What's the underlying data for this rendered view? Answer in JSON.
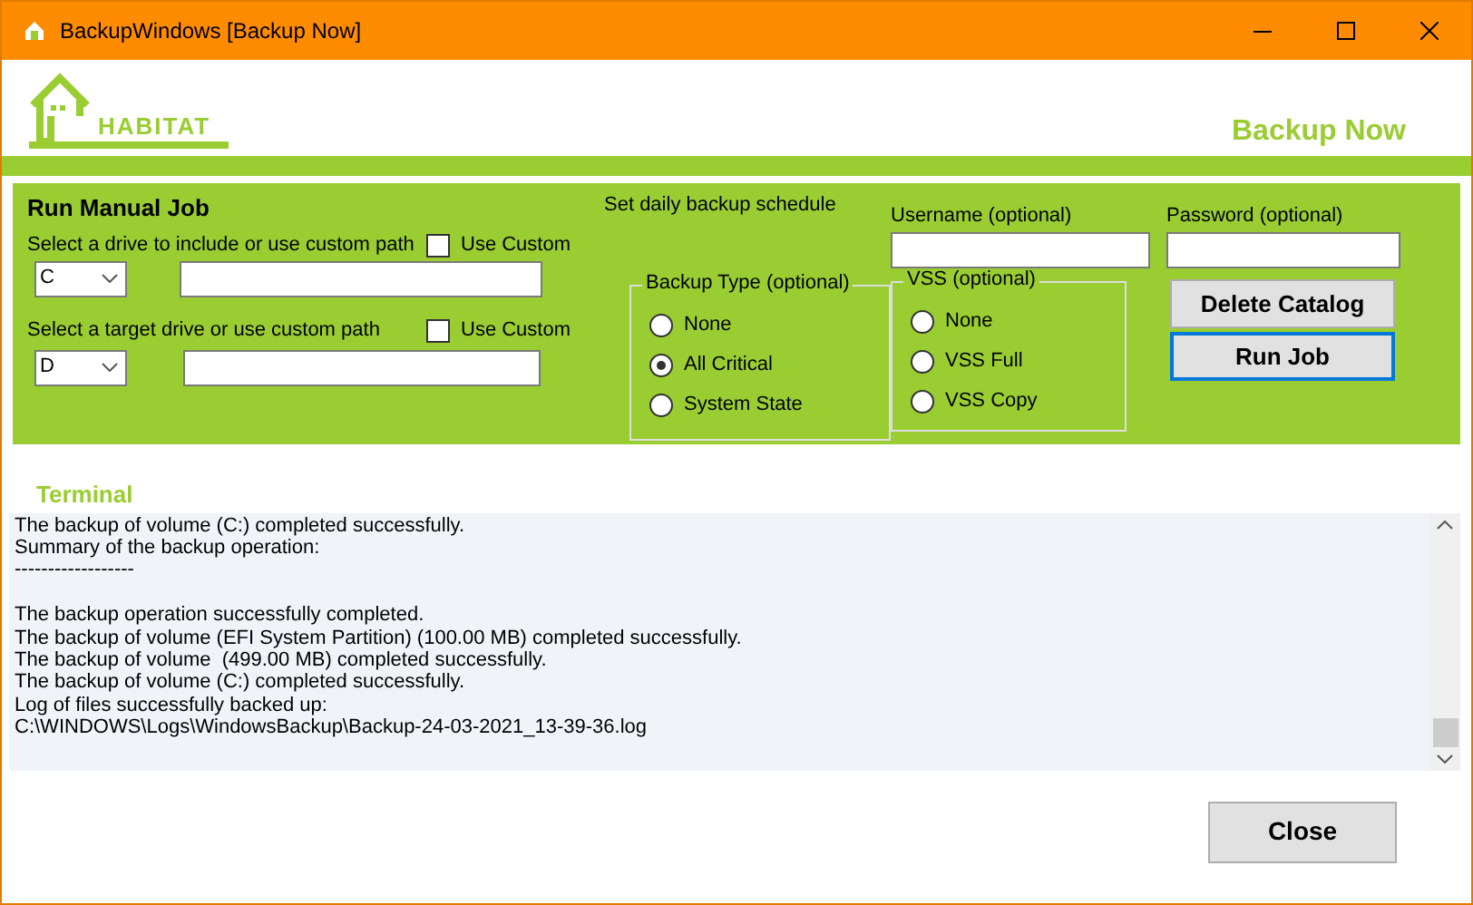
{
  "window": {
    "title": "BackupWindows [Backup Now]"
  },
  "header": {
    "logo_text": "HABITAT",
    "page_title": "Backup Now"
  },
  "manual_job": {
    "title": "Run Manual Job",
    "source": {
      "label": "Select a drive to include or use custom path",
      "use_custom": {
        "label": "Use Custom",
        "checked": false
      },
      "drive": "C"
    },
    "target": {
      "label": "Select a target drive or use custom path",
      "use_custom": {
        "label": "Use Custom",
        "checked": false
      },
      "drive": "D"
    }
  },
  "schedule": {
    "label": "Set daily backup schedule"
  },
  "backup_type": {
    "legend": "Backup Type (optional)",
    "options": [
      {
        "label": "None",
        "selected": false
      },
      {
        "label": "All Critical",
        "selected": true
      },
      {
        "label": "System State",
        "selected": false
      }
    ]
  },
  "username": {
    "label": "Username (optional)"
  },
  "vss": {
    "legend": "VSS (optional)",
    "options": [
      {
        "label": "None",
        "selected": false
      },
      {
        "label": "VSS Full",
        "selected": false
      },
      {
        "label": "VSS Copy",
        "selected": false
      }
    ]
  },
  "password": {
    "label": "Password (optional)"
  },
  "buttons": [
    {
      "label": "Delete Catalog",
      "focused": false
    },
    {
      "label": "Run Job",
      "focused": true
    }
  ],
  "terminal": {
    "title": "Terminal",
    "text": "The backup of volume (C:) completed successfully.\nSummary of the backup operation:\n------------------\n\nThe backup operation successfully completed.\nThe backup of volume (EFI System Partition) (100.00 MB) completed successfully.\nThe backup of volume  (499.00 MB) completed successfully.\nThe backup of volume (C:) completed successfully.\nLog of files successfully backed up:\nC:\\WINDOWS\\Logs\\WindowsBackup\\Backup-24-03-2021_13-39-36.log"
  },
  "close_button": "Close"
}
